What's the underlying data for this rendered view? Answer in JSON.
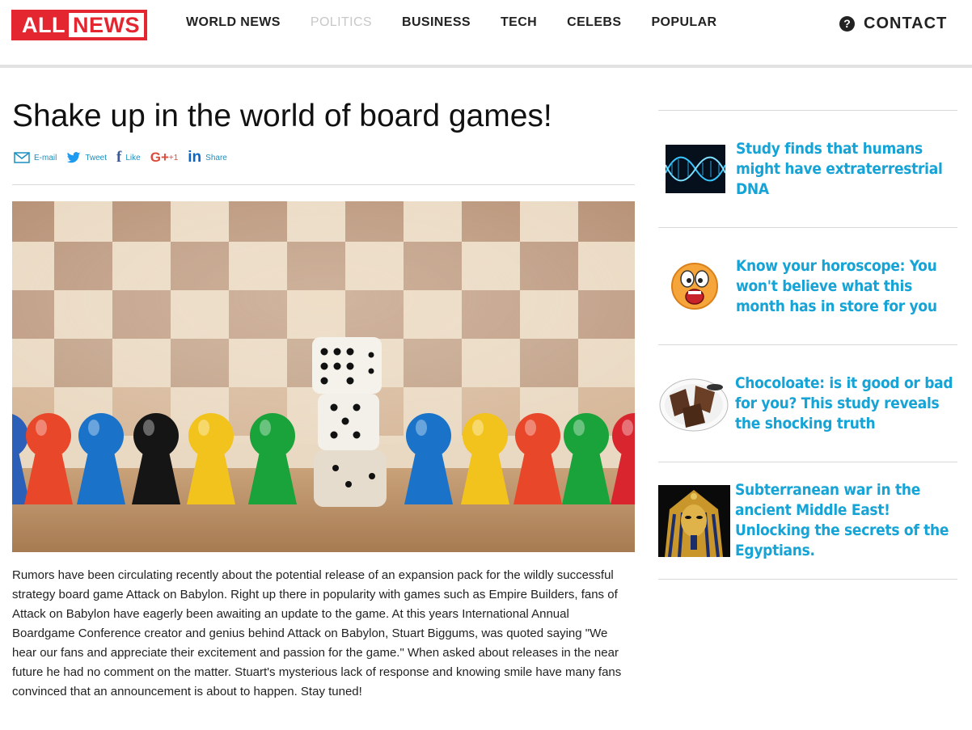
{
  "logo": {
    "part1": "ALL",
    "part2": "NEWS"
  },
  "nav": {
    "items": [
      {
        "label": "WORLD NEWS"
      },
      {
        "label": "POLITICS"
      },
      {
        "label": "BUSINESS"
      },
      {
        "label": "TECH"
      },
      {
        "label": "CELEBS"
      },
      {
        "label": "POPULAR"
      }
    ],
    "active": "POLITICS"
  },
  "contact": {
    "icon": "question-circle-icon",
    "label": "CONTACT"
  },
  "article": {
    "title": "Shake up in the world of board games!",
    "share": [
      {
        "icon": "email-icon",
        "label": "E-mail"
      },
      {
        "icon": "twitter-icon",
        "label": "Tweet"
      },
      {
        "icon": "facebook-icon",
        "label": "Like"
      },
      {
        "icon": "google-plus-icon",
        "label": "+1"
      },
      {
        "icon": "linkedin-icon",
        "label": "Share"
      }
    ],
    "hero_image": "board-game-pawns-and-dice",
    "body": "Rumors have been circulating recently about the potential release of an expansion pack for the wildly successful strategy board game Attack on Babylon. Right up there in popularity with games such as Empire Builders, fans of Attack on Babylon have eagerly been awaiting an update to the game. At this years International Annual Boardgame Conference creator and genius behind Attack on Babylon, Stuart Biggums, was quoted saying \"We hear our fans and appreciate their excitement and passion for the game.\" When asked about releases in the near future he had no comment on the matter. Stuart's mysterious lack of response and knowing smile have many fans convinced that an announcement is about to happen. Stay tuned!"
  },
  "sidebar": {
    "items": [
      {
        "thumb": "dna-helix-thumbnail",
        "title": "Study finds that humans might have extraterrestrial DNA"
      },
      {
        "thumb": "shocked-emoji-thumbnail",
        "title": "Know your horoscope: You won't believe what this month has in store for you"
      },
      {
        "thumb": "chocolate-thumbnail",
        "title": "Chocoloate: is it good or bad for you? This study reveals the shocking truth"
      },
      {
        "thumb": "pharaoh-mask-thumbnail",
        "title": "Subterranean war in the ancient Middle East! Unlocking the secrets of the Egyptians."
      }
    ]
  },
  "colors": {
    "brand_red": "#e3262f",
    "link_blue": "#16a3d6",
    "nav_inactive": "#c8c8c8"
  }
}
